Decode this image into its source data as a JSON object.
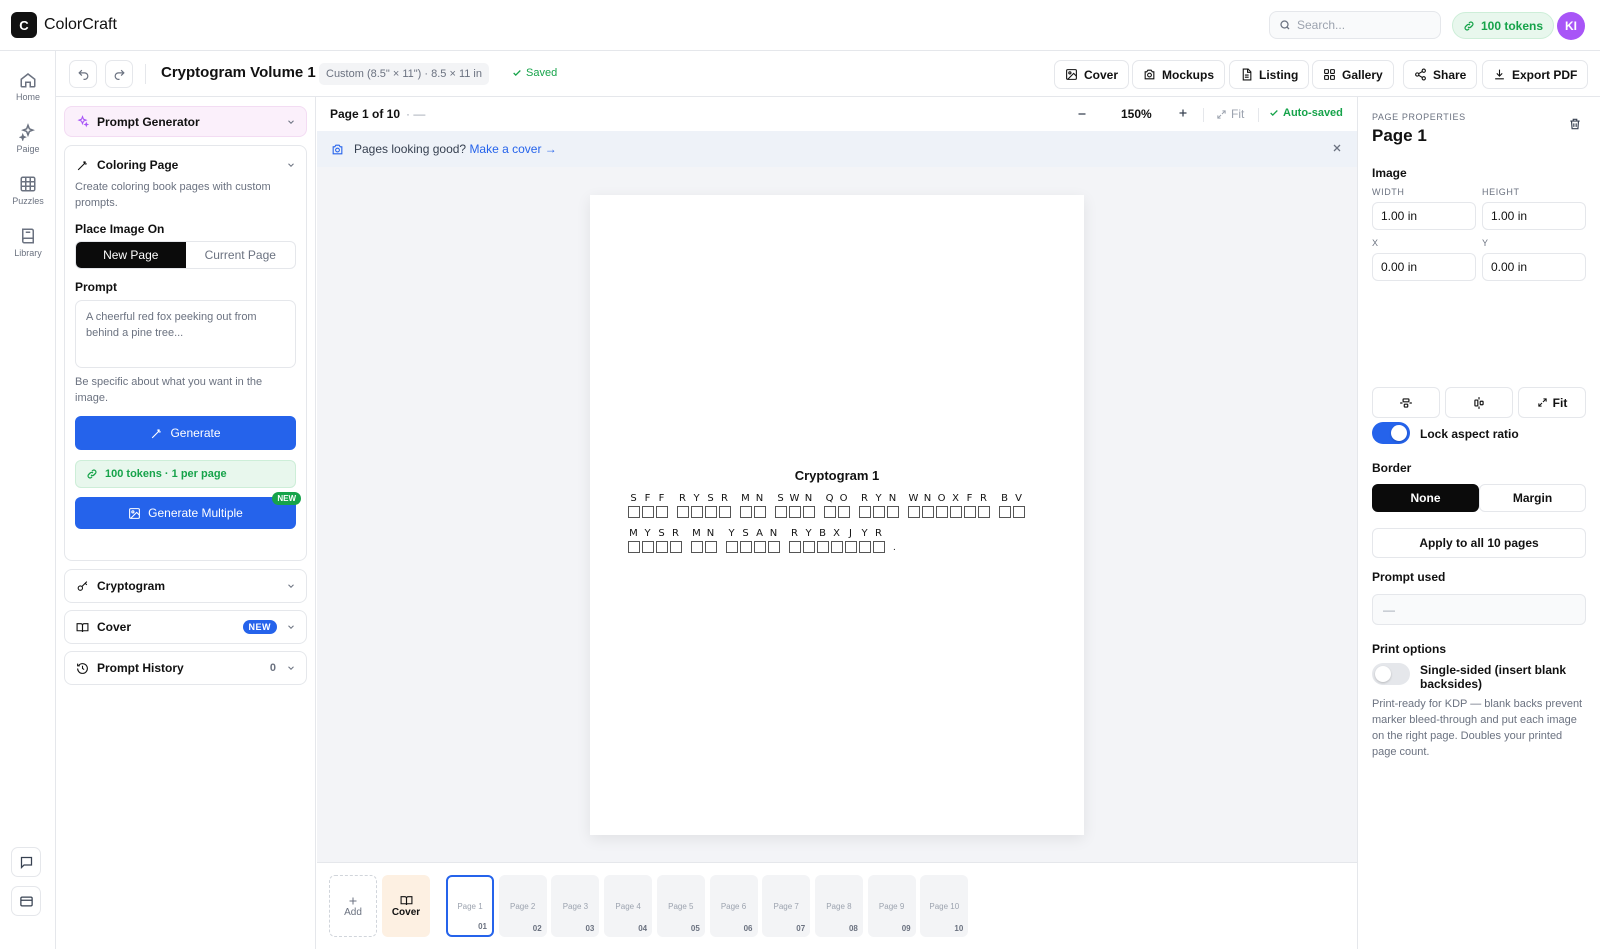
{
  "app": {
    "logo_letter": "C",
    "name": "ColorCraft"
  },
  "topbar": {
    "search_placeholder": "Search...",
    "tokens": "100 tokens",
    "avatar_initials": "KI"
  },
  "rail": {
    "items": [
      {
        "label": "Home"
      },
      {
        "label": "Paige"
      },
      {
        "label": "Puzzles"
      },
      {
        "label": "Library"
      }
    ]
  },
  "doc": {
    "title": "Cryptogram Volume 1",
    "size": "Custom (8.5\" × 11\") · 8.5 × 11 in",
    "status": "Saved",
    "actions": [
      "Cover",
      "Mockups",
      "Listing",
      "Gallery",
      "Share",
      "Export PDF"
    ]
  },
  "left_panel": {
    "prompt_generator": "Prompt Generator",
    "coloring_page": {
      "title": "Coloring Page",
      "description": "Create coloring book pages with custom prompts.",
      "place_label": "Place Image On",
      "options": [
        "New Page",
        "Current Page"
      ],
      "selected": "New Page",
      "prompt_label": "Prompt",
      "prompt_placeholder": "A cheerful red fox peeking out from behind a pine tree...",
      "hint": "Be specific about what you want in the image.",
      "generate": "Generate",
      "token_info": "100 tokens · 1 per page",
      "generate_multiple": "Generate Multiple",
      "new_tag": "NEW"
    },
    "cryptogram": "Cryptogram",
    "cover": "Cover",
    "cover_tag": "NEW",
    "prompt_history": "Prompt History",
    "prompt_history_count": "0"
  },
  "canvas": {
    "pager": "Page 1 of 10",
    "pager_extra": "·  —",
    "zoom": "150%",
    "fit": "Fit",
    "autosaved": "Auto-saved",
    "banner_text": "Pages looking good?",
    "banner_link": "Make a cover →",
    "puzzle": {
      "title": "Cryptogram 1",
      "line1": [
        "SFF",
        "RYSR",
        "MN",
        "SWN",
        "QO",
        "RYN",
        "WNOXFR",
        "BV"
      ],
      "line2": [
        "MYSR",
        "MN",
        "YSAN",
        "RYBXJYR"
      ],
      "end_punct": "."
    }
  },
  "strip": {
    "add_label": "Add",
    "cover_label": "Cover",
    "pages": [
      {
        "label": "Page 1",
        "num": "01"
      },
      {
        "label": "Page 2",
        "num": "02"
      },
      {
        "label": "Page 3",
        "num": "03"
      },
      {
        "label": "Page 4",
        "num": "04"
      },
      {
        "label": "Page 5",
        "num": "05"
      },
      {
        "label": "Page 6",
        "num": "06"
      },
      {
        "label": "Page 7",
        "num": "07"
      },
      {
        "label": "Page 8",
        "num": "08"
      },
      {
        "label": "Page 9",
        "num": "09"
      },
      {
        "label": "Page 10",
        "num": "10"
      }
    ],
    "active_index": 0
  },
  "right_panel": {
    "caption": "PAGE PROPERTIES",
    "title": "Page 1",
    "image_label": "Image",
    "width_label": "WIDTH",
    "height_label": "HEIGHT",
    "width": "1.00 in",
    "height": "1.00 in",
    "x_label": "X",
    "y_label": "Y",
    "x": "0.00 in",
    "y": "0.00 in",
    "fit_label": "Fit",
    "lock_aspect": "Lock aspect ratio",
    "lock_aspect_on": true,
    "border_label": "Border",
    "border_options": [
      "None",
      "Margin"
    ],
    "border_selected": "None",
    "apply_all": "Apply to all 10 pages",
    "prompt_used_label": "Prompt used",
    "prompt_used_value": "—",
    "print_options_label": "Print options",
    "single_sided": "Single-sided (insert blank backsides)",
    "single_sided_on": false,
    "print_desc": "Print-ready for KDP — blank backs prevent marker bleed-through and put each image on the right page. Doubles your printed page count."
  },
  "colors": {
    "accent": "#2563eb",
    "success": "#16a34a",
    "avatar": "#a855f7",
    "dark": "#0b0b0b"
  }
}
